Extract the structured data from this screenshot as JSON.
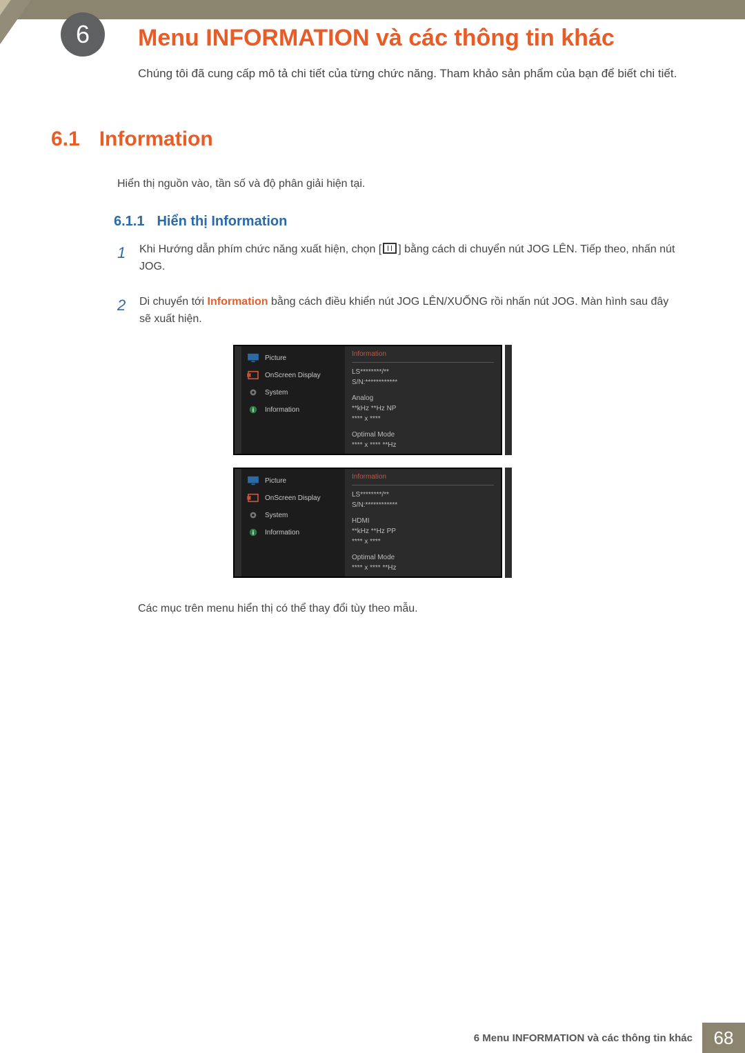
{
  "chapter": {
    "number": "6",
    "title": "Menu INFORMATION và các thông tin khác"
  },
  "intro": "Chúng tôi đã cung cấp mô tả chi tiết của từng chức năng. Tham khảo sản phẩm của bạn để biết chi tiết.",
  "h2": {
    "num": "6.1",
    "title": "Information"
  },
  "p1": "Hiển thị nguồn vào, tần số và độ phân giải hiện tại.",
  "h3": {
    "num": "6.1.1",
    "title": "Hiển thị Information"
  },
  "steps": {
    "s1": {
      "num": "1",
      "a": "Khi Hướng dẫn phím chức năng xuất hiện, chọn [",
      "b": "] bằng cách di chuyển nút JOG LÊN. Tiếp theo, nhấn nút JOG."
    },
    "s2": {
      "num": "2",
      "a": "Di chuyển tới ",
      "em": "Information",
      "b": " bằng cách điều khiển nút JOG LÊN/XUỐNG rồi nhấn nút JOG. Màn hình sau đây sẽ xuất hiện."
    }
  },
  "osd": {
    "items": [
      "Picture",
      "OnScreen Display",
      "System",
      "Information"
    ],
    "pane_title": "Information",
    "panel1": {
      "model": "LS********/**",
      "sn": "S/N:************",
      "src": "Analog",
      "freq": "**kHz **Hz NP",
      "res": "**** x ****",
      "opt_label": "Optimal Mode",
      "opt": "**** x **** **Hz"
    },
    "panel2": {
      "model": "LS********/**",
      "sn": "S/N:************",
      "src": "HDMI",
      "freq": "**kHz **Hz PP",
      "res": "**** x ****",
      "opt_label": "Optimal Mode",
      "opt": "**** x **** **Hz"
    }
  },
  "caption": "Các mục trên menu hiển thị có thể thay đổi tùy theo mẫu.",
  "footer": {
    "text": "6 Menu INFORMATION và các thông tin khác",
    "page": "68"
  }
}
